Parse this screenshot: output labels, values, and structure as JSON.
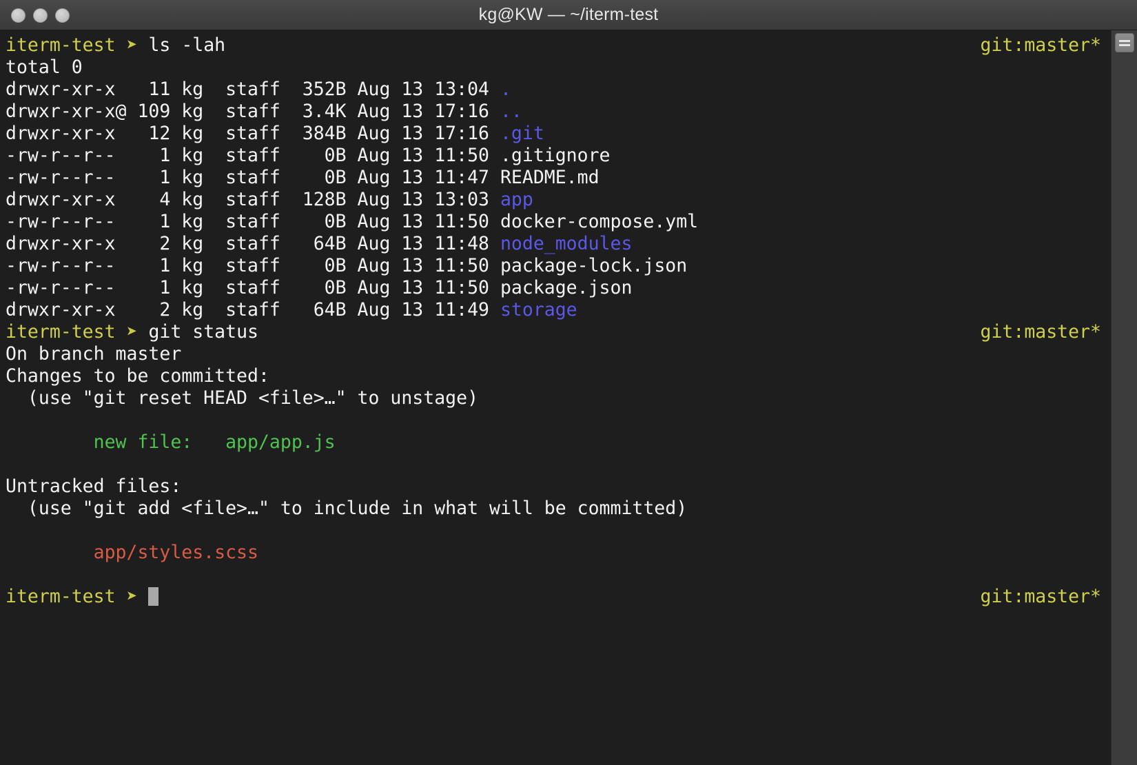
{
  "window": {
    "title": "kg@KW — ~/iterm-test",
    "traffic_lights": [
      "close-button",
      "minimize-button",
      "zoom-button"
    ],
    "background_color": "#1e1e1e",
    "titlebar_color": "#414141"
  },
  "colors": {
    "prompt": "#cfd04b",
    "arrow": "#c9cc3f",
    "text": "#f2f2f2",
    "directory": "#5b58e8",
    "staged_green": "#4fc24f",
    "untracked_red": "#d85b46",
    "cursor": "#a8a8a8"
  },
  "prompt": {
    "label": "iterm-test",
    "arrow": "➤",
    "git_branch": "git:master*"
  },
  "lines": [
    {
      "type": "prompt",
      "command": "ls -lah",
      "git": "git:master*"
    },
    {
      "type": "out",
      "text": "total 0"
    },
    {
      "type": "ls",
      "perms": "drwxr-xr-x ",
      "links": " 11",
      "user": "kg",
      "group": "staff",
      "size": "352B",
      "date": "Aug 13 13:04",
      "name": ".",
      "color": "dir"
    },
    {
      "type": "ls",
      "perms": "drwxr-xr-x@",
      "links": "109",
      "user": "kg",
      "group": "staff",
      "size": "3.4K",
      "date": "Aug 13 17:16",
      "name": "..",
      "color": "dir"
    },
    {
      "type": "ls",
      "perms": "drwxr-xr-x ",
      "links": " 12",
      "user": "kg",
      "group": "staff",
      "size": "384B",
      "date": "Aug 13 17:16",
      "name": ".git",
      "color": "dir"
    },
    {
      "type": "ls",
      "perms": "-rw-r--r-- ",
      "links": "  1",
      "user": "kg",
      "group": "staff",
      "size": "  0B",
      "date": "Aug 13 11:50",
      "name": ".gitignore",
      "color": "white"
    },
    {
      "type": "ls",
      "perms": "-rw-r--r-- ",
      "links": "  1",
      "user": "kg",
      "group": "staff",
      "size": "  0B",
      "date": "Aug 13 11:47",
      "name": "README.md",
      "color": "white"
    },
    {
      "type": "ls",
      "perms": "drwxr-xr-x ",
      "links": "  4",
      "user": "kg",
      "group": "staff",
      "size": "128B",
      "date": "Aug 13 13:03",
      "name": "app",
      "color": "dir"
    },
    {
      "type": "ls",
      "perms": "-rw-r--r-- ",
      "links": "  1",
      "user": "kg",
      "group": "staff",
      "size": "  0B",
      "date": "Aug 13 11:50",
      "name": "docker-compose.yml",
      "color": "white"
    },
    {
      "type": "ls",
      "perms": "drwxr-xr-x ",
      "links": "  2",
      "user": "kg",
      "group": "staff",
      "size": " 64B",
      "date": "Aug 13 11:48",
      "name": "node_modules",
      "color": "dir"
    },
    {
      "type": "ls",
      "perms": "-rw-r--r-- ",
      "links": "  1",
      "user": "kg",
      "group": "staff",
      "size": "  0B",
      "date": "Aug 13 11:50",
      "name": "package-lock.json",
      "color": "white"
    },
    {
      "type": "ls",
      "perms": "-rw-r--r-- ",
      "links": "  1",
      "user": "kg",
      "group": "staff",
      "size": "  0B",
      "date": "Aug 13 11:50",
      "name": "package.json",
      "color": "white"
    },
    {
      "type": "ls",
      "perms": "drwxr-xr-x ",
      "links": "  2",
      "user": "kg",
      "group": "staff",
      "size": " 64B",
      "date": "Aug 13 11:49",
      "name": "storage",
      "color": "dir"
    },
    {
      "type": "prompt",
      "command": "git status",
      "git": "git:master*"
    },
    {
      "type": "out",
      "text": "On branch master"
    },
    {
      "type": "out",
      "text": "Changes to be committed:"
    },
    {
      "type": "out",
      "text": "  (use \"git reset HEAD <file>…\" to unstage)"
    },
    {
      "type": "blank",
      "text": ""
    },
    {
      "type": "green",
      "text": "        new file:   app/app.js"
    },
    {
      "type": "blank",
      "text": ""
    },
    {
      "type": "out",
      "text": "Untracked files:"
    },
    {
      "type": "out",
      "text": "  (use \"git add <file>…\" to include in what will be committed)"
    },
    {
      "type": "blank",
      "text": ""
    },
    {
      "type": "red",
      "text": "        app/styles.scss"
    },
    {
      "type": "blank",
      "text": ""
    },
    {
      "type": "cursor-prompt",
      "command": "",
      "git": "git:master*"
    }
  ],
  "scrollbar": {
    "thumb_name": "scroll-thumb"
  }
}
